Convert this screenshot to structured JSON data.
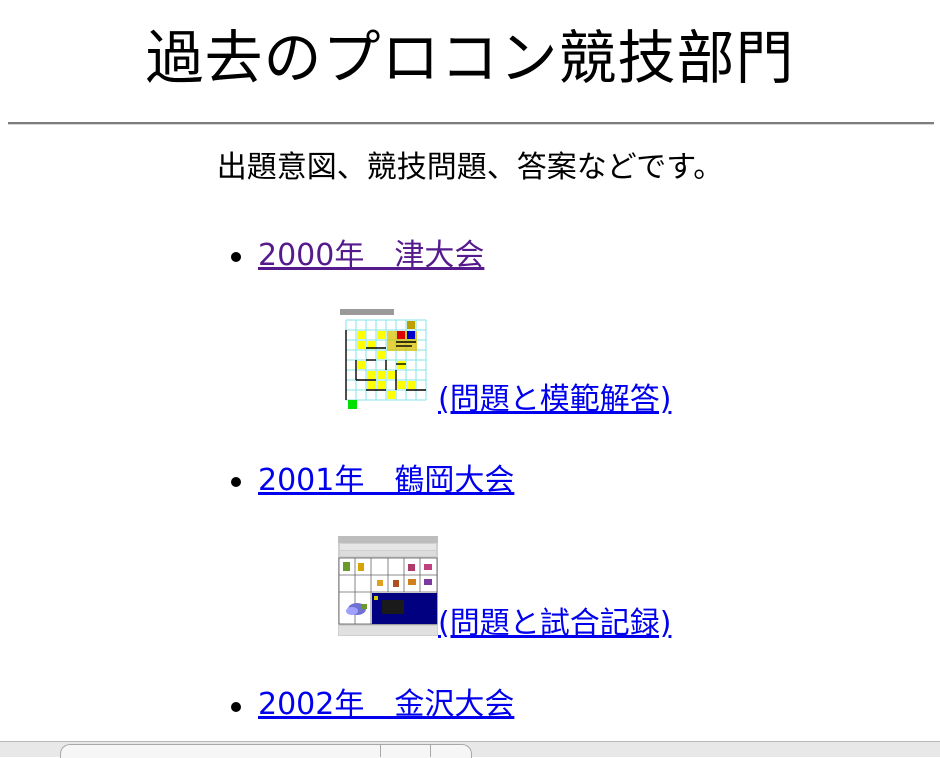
{
  "page": {
    "title": "過去のプロコン競技部門",
    "subtitle": "出題意図、競技問題、答案などです。"
  },
  "entries": [
    {
      "year_label": "2000年　津大会",
      "detail_label": "(問題と模範解答)"
    },
    {
      "year_label": "2001年　鶴岡大会",
      "detail_label": "(問題と試合記録)"
    },
    {
      "year_label": "2002年　金沢大会"
    }
  ],
  "colors": {
    "visited_link": "#551a8b",
    "link": "#0000ee"
  }
}
